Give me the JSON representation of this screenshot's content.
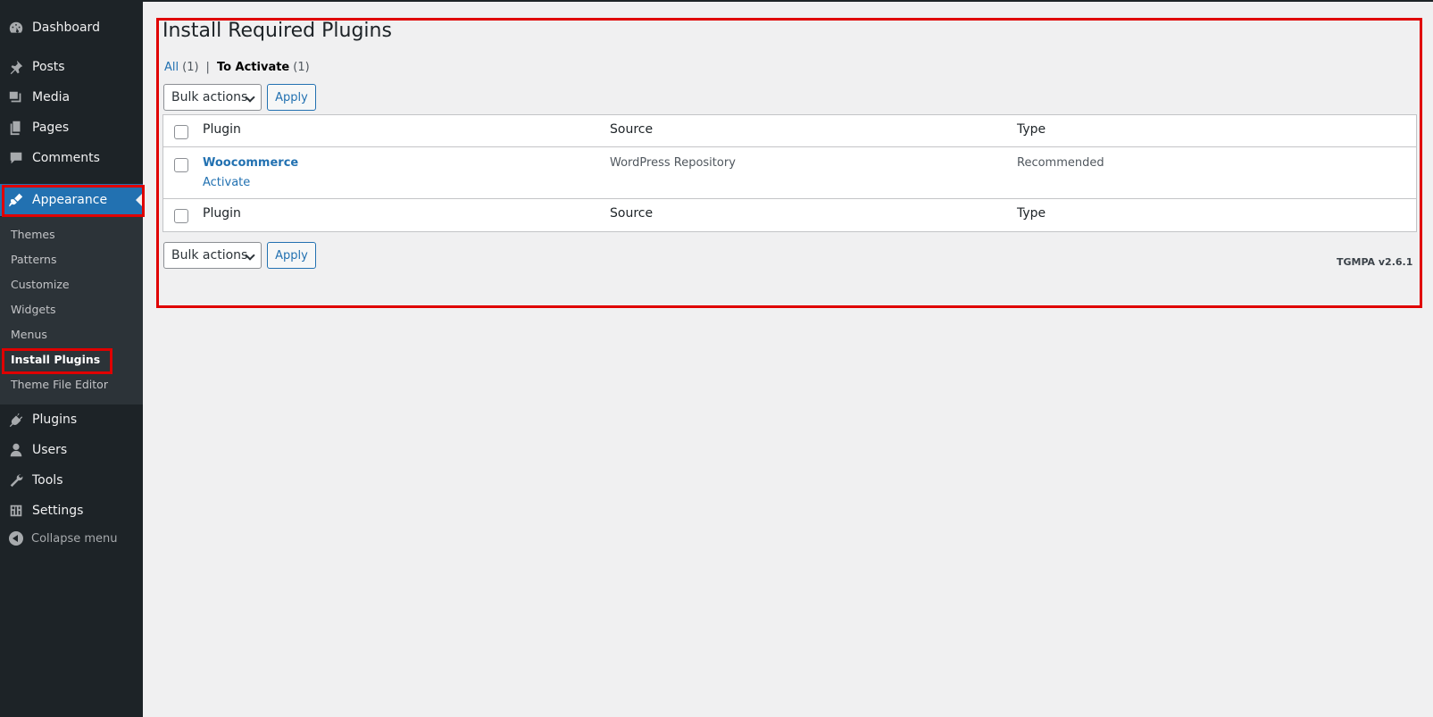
{
  "sidebar": {
    "items": [
      {
        "label": "Dashboard",
        "icon": "dashboard-icon"
      },
      {
        "label": "Posts",
        "icon": "pushpin-icon"
      },
      {
        "label": "Media",
        "icon": "media-icon"
      },
      {
        "label": "Pages",
        "icon": "pages-icon"
      },
      {
        "label": "Comments",
        "icon": "comments-icon"
      },
      {
        "label": "Appearance",
        "icon": "paintbrush-icon"
      },
      {
        "label": "Plugins",
        "icon": "plugin-icon"
      },
      {
        "label": "Users",
        "icon": "users-icon"
      },
      {
        "label": "Tools",
        "icon": "wrench-icon"
      },
      {
        "label": "Settings",
        "icon": "settings-icon"
      }
    ],
    "submenu": [
      "Themes",
      "Patterns",
      "Customize",
      "Widgets",
      "Menus",
      "Install Plugins",
      "Theme File Editor"
    ],
    "collapse_label": "Collapse menu"
  },
  "main": {
    "title": "Install Required Plugins",
    "filters": {
      "all_label": "All",
      "all_count": "(1)",
      "separator": "|",
      "to_activate_label": "To Activate",
      "to_activate_count": "(1)"
    },
    "bulk_actions_label": "Bulk actions",
    "apply_label": "Apply",
    "columns": [
      "Plugin",
      "Source",
      "Type"
    ],
    "rows": [
      {
        "plugin": "Woocommerce",
        "action": "Activate",
        "source": "WordPress Repository",
        "type": "Recommended"
      }
    ],
    "version": "TGMPA v2.6.1"
  },
  "colors": {
    "sidebar_bg": "#1d2327",
    "accent": "#2271b1",
    "highlight_border": "#e00000"
  }
}
